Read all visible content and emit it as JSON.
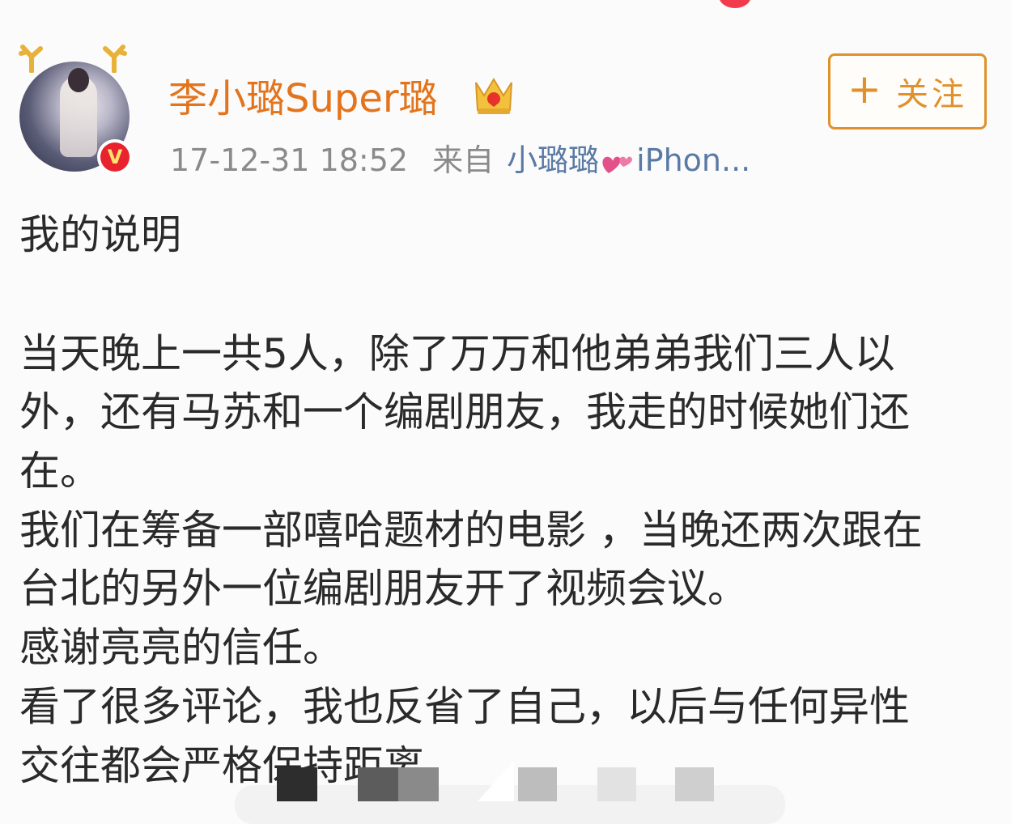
{
  "user": {
    "name": "李小璐Super璐"
  },
  "meta": {
    "timestamp": "17-12-31 18:52",
    "from_label": "来自",
    "source_name": "小璐璐",
    "source_device": "iPhon..."
  },
  "follow_button": {
    "plus": "+",
    "label": "关注"
  },
  "post": {
    "title": "我的说明",
    "lines": [
      "当天晚上一共5人，除了万万和他弟弟我们三人以",
      "外，还有马苏和一个编剧朋友，我走的时候她们还",
      "在。",
      "我们在筹备一部嘻哈题材的电影 ，当晚还两次跟在",
      "台北的另外一位编剧朋友开了视频会议。",
      "感谢亮亮的信任。",
      "看了很多评论，我也反省了自己，以后与任何异性",
      "交往都会严格保持距离"
    ]
  },
  "colors": {
    "username": "#e3741c",
    "follow_accent": "#e0912b",
    "meta_text": "#8a8a8a",
    "source_link": "#5a7aa6",
    "verified_badge": "#e8232f",
    "heart": "#e4508a"
  },
  "icons": {
    "avatar": "avatar-with-antlers",
    "verified": "verified-v-icon",
    "member": "crown-icon",
    "source": "heart-icon"
  }
}
